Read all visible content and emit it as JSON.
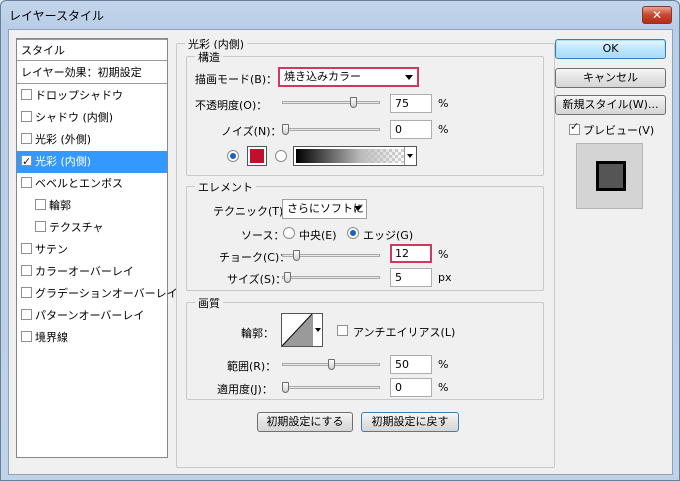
{
  "window": {
    "title": "レイヤースタイル",
    "close": "✕"
  },
  "sidebar": {
    "header": "スタイル",
    "effects_header": "レイヤー効果：初期設定",
    "items": [
      {
        "label": "ドロップシャドウ",
        "checked": false
      },
      {
        "label": "シャドウ (内側)",
        "checked": false
      },
      {
        "label": "光彩 (外側)",
        "checked": false
      },
      {
        "label": "光彩 (内側)",
        "checked": true,
        "selected": true
      },
      {
        "label": "ベベルとエンボス",
        "checked": false
      },
      {
        "label": "輪郭",
        "checked": false,
        "indent": true
      },
      {
        "label": "テクスチャ",
        "checked": false,
        "indent": true
      },
      {
        "label": "サテン",
        "checked": false
      },
      {
        "label": "カラーオーバーレイ",
        "checked": false
      },
      {
        "label": "グラデーションオーバーレイ",
        "checked": false
      },
      {
        "label": "パターンオーバーレイ",
        "checked": false
      },
      {
        "label": "境界線",
        "checked": false
      }
    ]
  },
  "inner_glow": {
    "title": "光彩 (内側)",
    "structure": {
      "title": "構造",
      "blend_mode_label": "描画モード(B)：",
      "blend_mode_value": "焼き込みカラー",
      "opacity_label": "不透明度(O)：",
      "opacity_value": "75",
      "opacity_level": 0.75,
      "noise_label": "ノイズ(N)：",
      "noise_value": "0",
      "noise_level": 0,
      "percent": "%",
      "color_swatch": "#c0102e"
    },
    "elements": {
      "title": "エレメント",
      "technique_label": "テクニック(T)：",
      "technique_value": "さらにソフトに",
      "source_label": "ソース：",
      "source_center": "中央(E)",
      "source_edge": "エッジ(G)",
      "choke_label": "チョーク(C)：",
      "choke_value": "12",
      "choke_level": 0.12,
      "size_label": "サイズ(S)：",
      "size_value": "5",
      "size_unit": "px"
    },
    "quality": {
      "title": "画質",
      "contour_label": "輪郭：",
      "antialias_label": "アンチエイリアス(L)",
      "range_label": "範囲(R)：",
      "range_value": "50",
      "range_level": 0.5,
      "jitter_label": "適用度(J)：",
      "jitter_value": "0",
      "jitter_level": 0
    },
    "make_default": "初期設定にする",
    "reset_default": "初期設定に戻す"
  },
  "buttons": {
    "ok": "OK",
    "cancel": "キャンセル",
    "new_style": "新規スタイル(W)...",
    "preview": "プレビュー(V)"
  }
}
